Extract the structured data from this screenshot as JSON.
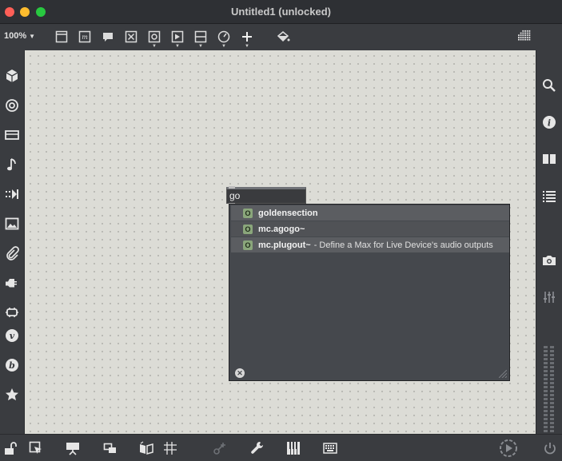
{
  "window": {
    "title": "Untitled1 (unlocked)"
  },
  "toolbar": {
    "zoom": "100%",
    "icons": [
      "presentation-mode-icon",
      "message-icon",
      "comment-icon",
      "toggle-icon",
      "button-icon",
      "playbar-icon",
      "slider-icon",
      "dial-icon",
      "add-icon",
      "paint-bucket-icon",
      "grid-view-icon"
    ]
  },
  "left_sidebar": {
    "icons": [
      "cube-icon",
      "target-icon",
      "device-icon",
      "music-note-icon",
      "sequence-icon",
      "image-icon",
      "paperclip-icon",
      "plug-icon",
      "patch-cord-icon",
      "vst-icon",
      "bpatcher-icon",
      "star-icon"
    ]
  },
  "right_sidebar": {
    "icons": [
      "search-icon",
      "info-icon",
      "book-icon",
      "list-icon",
      "camera-icon",
      "mixer-icon"
    ]
  },
  "object_box": {
    "text": "go"
  },
  "suggestions": [
    {
      "badge": "O",
      "name": "goldensection",
      "description": ""
    },
    {
      "badge": "O",
      "name": "mc.agogo~",
      "description": ""
    },
    {
      "badge": "O",
      "name": "mc.plugout~",
      "description": "- Define a Max for Live Device's audio outputs"
    }
  ],
  "bottom_bar": {
    "icons": [
      "lock-icon",
      "edit-cursor-icon",
      "presentation-icon",
      "layers-icon",
      "arrange-icon",
      "grid-icon",
      "connect-icon",
      "wrench-icon",
      "keyboard-piano-icon",
      "computer-keyboard-icon",
      "audio-on-icon",
      "power-icon"
    ]
  },
  "colors": {
    "canvas": "#dcdcd6",
    "chrome": "#3a3c40",
    "popup": "#45484d",
    "badge": "#8aa67b"
  }
}
